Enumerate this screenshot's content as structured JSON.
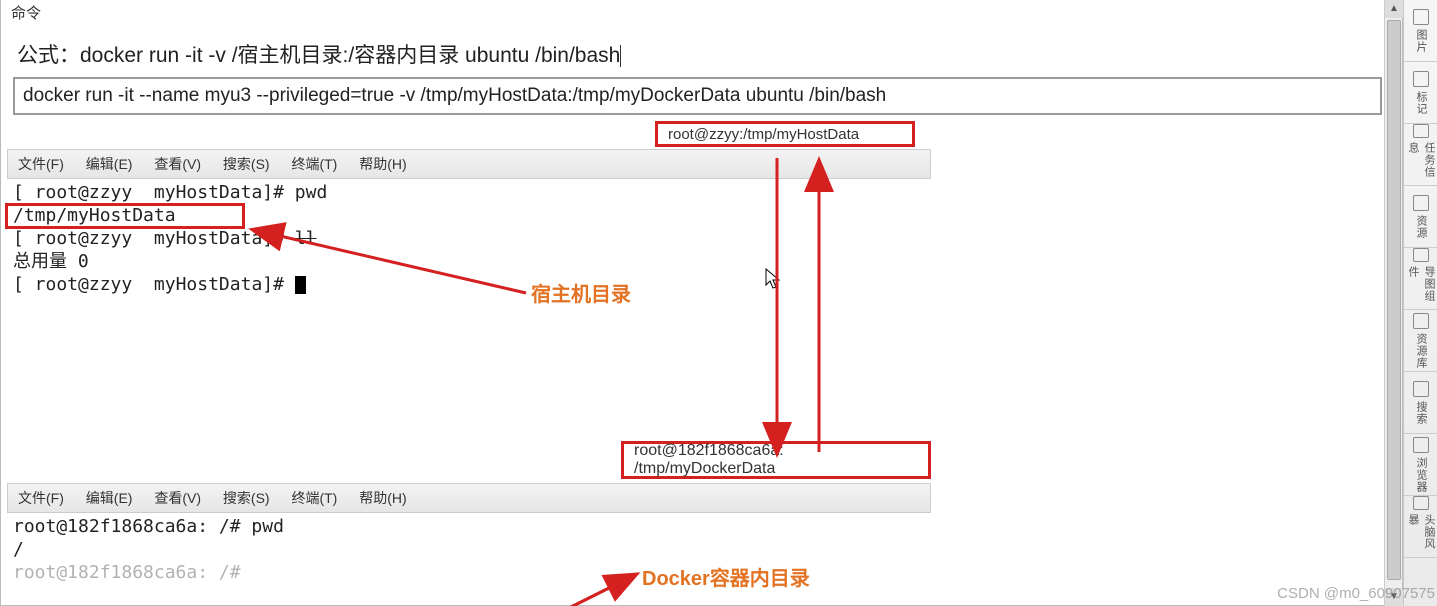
{
  "header": {
    "title": "命令"
  },
  "formula": {
    "prefix": "公式：",
    "text": "docker run -it -v /宿主机目录:/容器内目录 ubuntu /bin/bash"
  },
  "command_box": "docker run -it --name myu3 --privileged=true -v /tmp/myHostData:/tmp/myDockerData ubuntu /bin/bash",
  "term1": {
    "tab_title": "root@zzyy:/tmp/myHostData",
    "menu": {
      "file": "文件(F)",
      "edit": "编辑(E)",
      "view": "查看(V)",
      "search": "搜索(S)",
      "terminal": "终端(T)",
      "help": "帮助(H)"
    },
    "lines": {
      "l1_host": "[ root@zzyy",
      "l1_path": "myHostData]#",
      "l1_cmd": "pwd",
      "l2": "/tmp/myHostData",
      "l3_host": "[ root@zzyy",
      "l3_path": "myHostData]#",
      "l3_cmd": "ll",
      "l4": "总用量  0",
      "l5_host": "[ root@zzyy",
      "l5_path": "myHostData]#"
    }
  },
  "term2": {
    "tab_title": "root@182f1868ca6a: /tmp/myDockerData",
    "menu": {
      "file": "文件(F)",
      "edit": "编辑(E)",
      "view": "查看(V)",
      "search": "搜索(S)",
      "terminal": "终端(T)",
      "help": "帮助(H)"
    },
    "lines": {
      "l1": "root@182f1868ca6a: /#  pwd",
      "l2": "/",
      "l3": "root@182f1868ca6a: /#"
    }
  },
  "annotations": {
    "host_label": "宿主机目录",
    "docker_label": "Docker容器内目录"
  },
  "right_panel": [
    {
      "label": "图片",
      "name": "rp-image"
    },
    {
      "label": "标记",
      "name": "rp-mark"
    },
    {
      "label": "任务信息",
      "name": "rp-task"
    },
    {
      "label": "资源",
      "name": "rp-resource"
    },
    {
      "label": "导图组件",
      "name": "rp-mind"
    },
    {
      "label": "资源库",
      "name": "rp-lib"
    },
    {
      "label": "搜索",
      "name": "rp-search"
    },
    {
      "label": "浏览器",
      "name": "rp-browser"
    },
    {
      "label": "头脑风暴",
      "name": "rp-brain"
    }
  ],
  "watermark": "CSDN @m0_60907575"
}
